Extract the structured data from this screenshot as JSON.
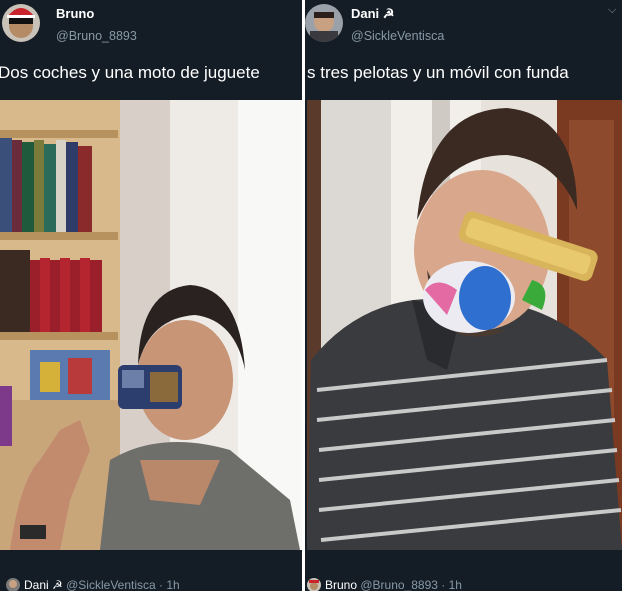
{
  "left_tweet": {
    "display_name": "Bruno",
    "handle": "@Bruno_8893",
    "text": "Dos coches y una moto de juguete",
    "reply": {
      "name": "Dani ☭",
      "handle": "@SickleVentisca",
      "time": "1h"
    }
  },
  "right_tweet": {
    "display_name": "Dani ☭",
    "handle": "@SickleVentisca",
    "text": "s tres pelotas y un móvil con funda",
    "reply": {
      "name": "Bruno",
      "handle": "@Bruno_8893",
      "time": "1h"
    }
  },
  "icons": {
    "menu": "chevron-down-icon"
  },
  "colors": {
    "background": "#141d26",
    "secondary_text": "#8899a6"
  }
}
